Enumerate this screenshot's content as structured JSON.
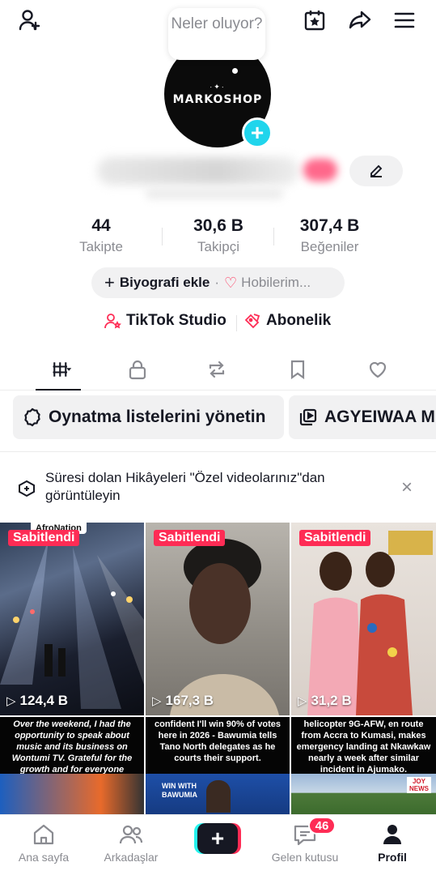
{
  "bubble": {
    "text": "Neler oluyor?"
  },
  "avatar": {
    "brand": "MARKOSHOP"
  },
  "stats": [
    {
      "value": "44",
      "label": "Takipte"
    },
    {
      "value": "30,6 B",
      "label": "Takipçi"
    },
    {
      "value": "307,4 B",
      "label": "Beğeniler"
    }
  ],
  "bio": {
    "add_label": "Biyografi ekle",
    "hobbies": "Hobilerim..."
  },
  "links": {
    "studio": "TikTok Studio",
    "subscription": "Abonelik"
  },
  "chips": {
    "manage": "Oynatma listelerini yönetin",
    "playlist": "AGYEIWAA M"
  },
  "notice": {
    "text": "Süresi dolan Hikâyeleri \"Özel videolarınız\"dan görüntüleyin",
    "close": "×"
  },
  "videos": [
    {
      "pin": "Sabitlendi",
      "views": "124,4 B",
      "top_text": "AfroNation"
    },
    {
      "pin": "Sabitlendi",
      "views": "167,3 B"
    },
    {
      "pin": "Sabitlendi",
      "views": "31,2 B"
    }
  ],
  "second_row": [
    {
      "caption": "Over the weekend, I had the opportunity to speak about music and its business on Wontumi TV. Grateful for the growth and for everyone supporting the journey ❤️"
    },
    {
      "caption": "confident I'll win 90% of votes here in 2026 - Bawumia tells Tano North delegates as he courts their support.",
      "tag": "WIN WITH BAWUMIA"
    },
    {
      "caption": "helicopter 9G-AFW, en route from Accra to Kumasi, makes emergency landing at Nkawkaw nearly a week after similar incident in Ajumako.",
      "tag": "JOY NEWS"
    }
  ],
  "nav": {
    "home": "Ana sayfa",
    "friends": "Arkadaşlar",
    "create": "+",
    "inbox": "Gelen kutusu",
    "inbox_badge": "46",
    "profile": "Profil"
  },
  "colors": {
    "accent": "#fe2c55",
    "cyan": "#25f4ee",
    "avatar_add": "#20d5ec",
    "text": "#161823",
    "muted": "#8a8b91"
  }
}
